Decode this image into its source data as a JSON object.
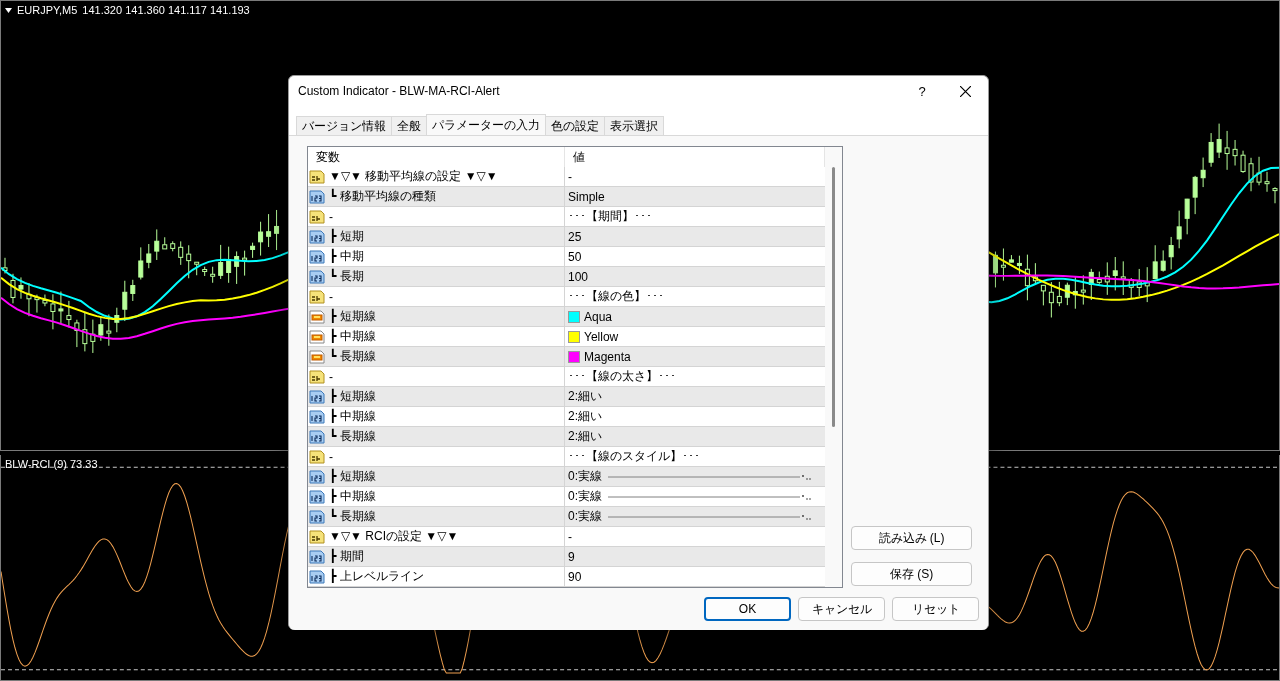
{
  "chart": {
    "symbol": "EURJPY,M5",
    "prices": "141.320 141.360 141.117 141.193"
  },
  "indicator": {
    "label": "BLW-RCI (9) 73.33"
  },
  "dialog": {
    "title": "Custom Indicator - BLW-MA-RCI-Alert",
    "help": "?",
    "tabs": [
      {
        "label": "バージョン情報",
        "selected": false
      },
      {
        "label": "全般",
        "selected": false
      },
      {
        "label": "パラメーターの入力",
        "selected": true
      },
      {
        "label": "色の設定",
        "selected": false
      },
      {
        "label": "表示選択",
        "selected": false
      }
    ],
    "table": {
      "columns": [
        "変数",
        "値"
      ],
      "rows": [
        {
          "kind": "string",
          "name": "▼▽▼ 移動平均線の設定 ▼▽▼",
          "value": "-"
        },
        {
          "kind": "int",
          "name": "┗ 移動平均線の種類",
          "value": "Simple"
        },
        {
          "kind": "string",
          "name": "-",
          "value": "･･･【期間】･･･"
        },
        {
          "kind": "int",
          "name": "┣ 短期",
          "value": "25"
        },
        {
          "kind": "int",
          "name": "┣ 中期",
          "value": "50"
        },
        {
          "kind": "int",
          "name": "┗ 長期",
          "value": "100"
        },
        {
          "kind": "string",
          "name": "-",
          "value": "･･･【線の色】･･･"
        },
        {
          "kind": "color",
          "name": "┣ 短期線",
          "value": "Aqua",
          "color": "#00ffff"
        },
        {
          "kind": "color",
          "name": "┣ 中期線",
          "value": "Yellow",
          "color": "#ffff00"
        },
        {
          "kind": "color",
          "name": "┗ 長期線",
          "value": "Magenta",
          "color": "#ff00ff"
        },
        {
          "kind": "string",
          "name": "-",
          "value": "･･･【線の太さ】･･･"
        },
        {
          "kind": "int",
          "name": "┣ 短期線",
          "value": "2:細い"
        },
        {
          "kind": "int",
          "name": "┣ 中期線",
          "value": "2:細い"
        },
        {
          "kind": "int",
          "name": "┗ 長期線",
          "value": "2:細い"
        },
        {
          "kind": "string",
          "name": "-",
          "value": "･･･【線のスタイル】･･･"
        },
        {
          "kind": "line",
          "name": "┣ 短期線",
          "value": "0:実線"
        },
        {
          "kind": "line",
          "name": "┣ 中期線",
          "value": "0:実線"
        },
        {
          "kind": "line",
          "name": "┗ 長期線",
          "value": "0:実線"
        },
        {
          "kind": "string",
          "name": "▼▽▼ RCIの設定 ▼▽▼",
          "value": "-"
        },
        {
          "kind": "int",
          "name": "┣ 期間",
          "value": "9"
        },
        {
          "kind": "int",
          "name": "┣ 上レベルライン",
          "value": "90"
        }
      ]
    },
    "side_buttons": [
      "読み込み (L)",
      "保存 (S)"
    ],
    "buttons": [
      {
        "label": "OK",
        "default": true
      },
      {
        "label": "キャンセル",
        "default": false
      },
      {
        "label": "リセット",
        "default": false
      }
    ]
  }
}
